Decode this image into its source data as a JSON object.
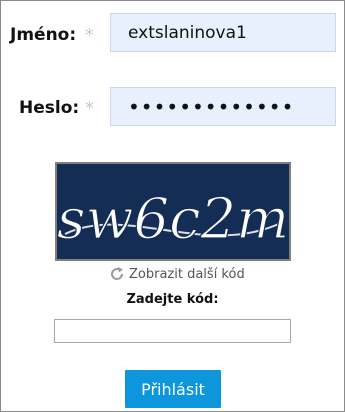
{
  "form": {
    "username": {
      "label": "Jméno:",
      "required_mark": "*",
      "value": "extslaninova1"
    },
    "password": {
      "label": "Heslo:",
      "required_mark": "*",
      "masked_value": "•••••••••••••"
    },
    "captcha": {
      "image_text": "sw6c2m",
      "reload_label": "Zobrazit další kód",
      "code_label": "Zadejte kód:",
      "code_value": ""
    },
    "submit_label": "Přihlásit"
  },
  "icons": {
    "reload": "refresh-icon"
  },
  "colors": {
    "field_bg": "#e8f0fe",
    "captcha_bg": "#142d55",
    "button_bg": "#0d96dc",
    "required_mark": "#c8c8c8"
  }
}
